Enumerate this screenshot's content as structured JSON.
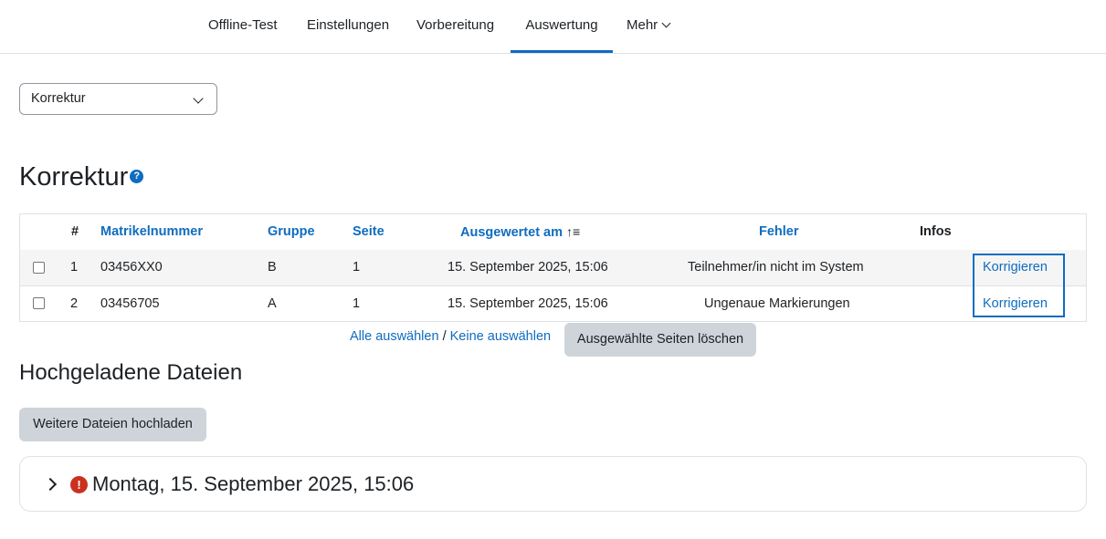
{
  "nav": {
    "tabs": [
      {
        "label": "Offline-Test"
      },
      {
        "label": "Einstellungen"
      },
      {
        "label": "Vorbereitung"
      },
      {
        "label": "Auswertung",
        "active": true
      },
      {
        "label": "Mehr"
      }
    ]
  },
  "view_select": {
    "value": "Korrektur"
  },
  "page_title": "Korrektur",
  "table": {
    "headers": {
      "num": "#",
      "matrikel": "Matrikelnummer",
      "gruppe": "Gruppe",
      "seite": "Seite",
      "ausgewertet": "Ausgewertet am",
      "fehler": "Fehler",
      "infos": "Infos"
    },
    "rows": [
      {
        "num": "1",
        "matrikel": "03456XX0",
        "gruppe": "B",
        "seite": "1",
        "ausgewertet": "15. September 2025, 15:06",
        "fehler": "Teilnehmer/in nicht im System",
        "action": "Korrigieren"
      },
      {
        "num": "2",
        "matrikel": "03456705",
        "gruppe": "A",
        "seite": "1",
        "ausgewertet": "15. September 2025, 15:06",
        "fehler": "Ungenaue Markierungen",
        "action": "Korrigieren"
      }
    ]
  },
  "selection": {
    "select_all": "Alle auswählen",
    "separator": "/",
    "select_none": "Keine auswählen",
    "delete_button": "Ausgewählte Seiten löschen"
  },
  "uploads": {
    "heading": "Hochgeladene Dateien",
    "upload_button": "Weitere Dateien hochladen",
    "items": [
      {
        "title": "Montag, 15. September 2025, 15:06",
        "status": "error"
      }
    ]
  },
  "colors": {
    "accent": "#0f6cbf",
    "error": "#ca3120",
    "button": "#ced4da"
  },
  "icons": {
    "help": "question-circle-icon",
    "sort": "sort-ascending-icon",
    "error": "exclamation-circle-icon",
    "expand": "chevron-right-icon"
  }
}
